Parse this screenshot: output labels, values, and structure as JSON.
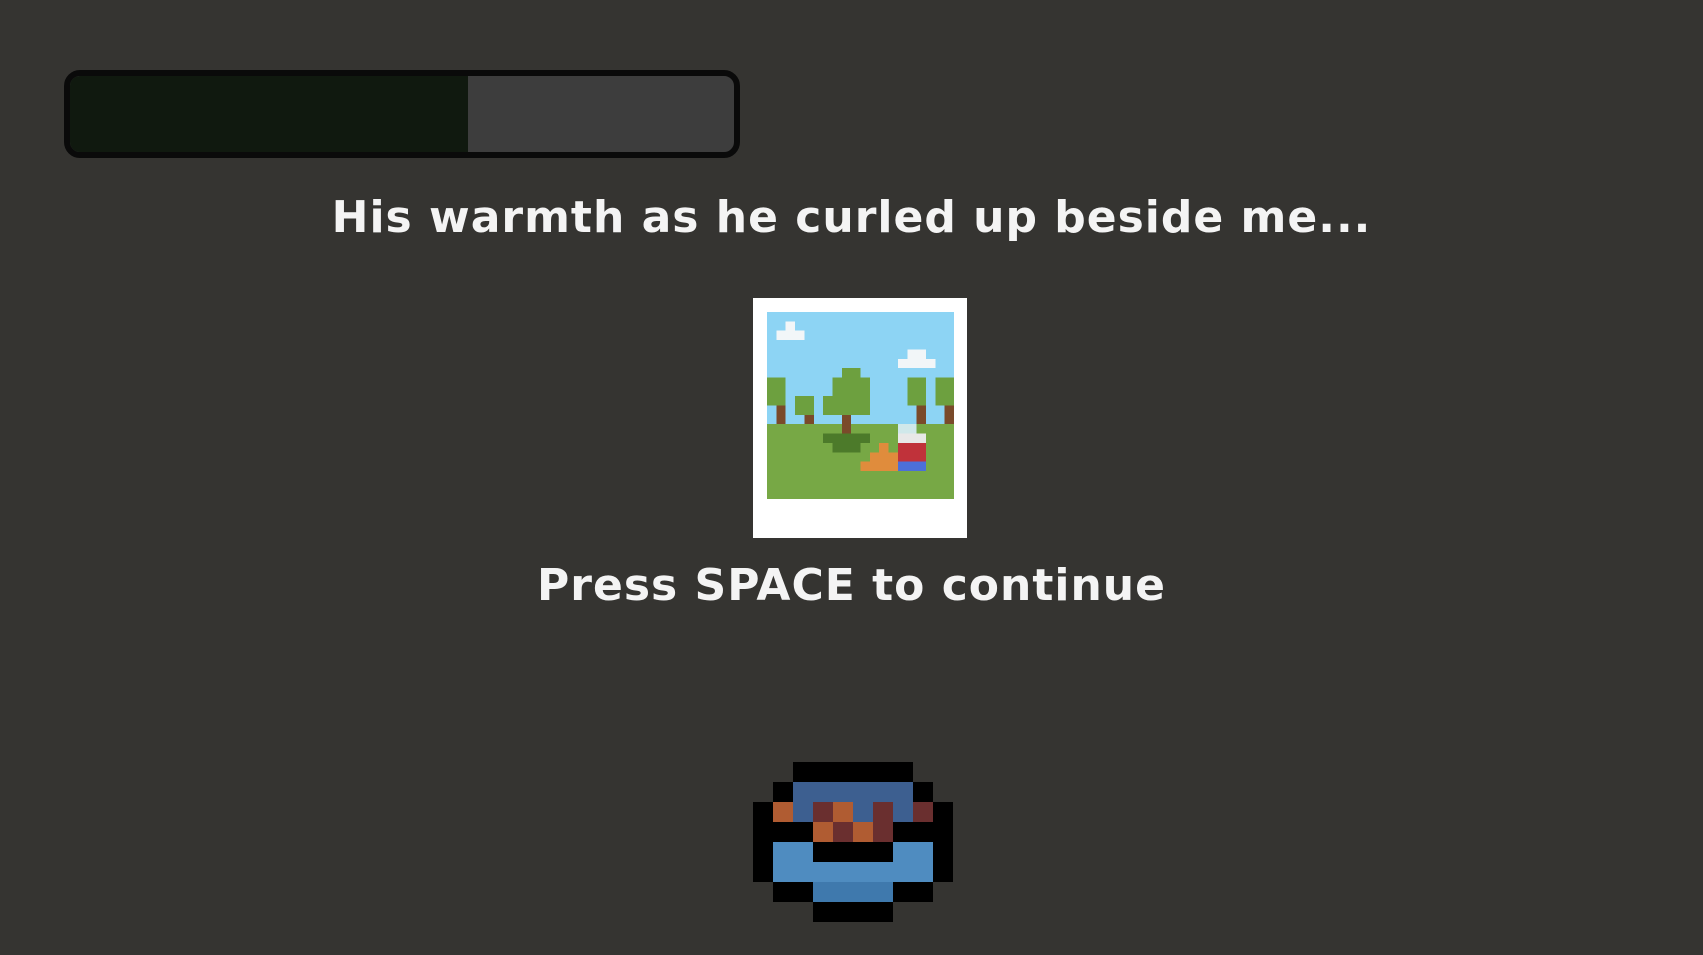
{
  "hud": {
    "progress_fraction": 0.6,
    "progress_fill_color": "#10190f",
    "progress_track_color": "#3d3d3d"
  },
  "dialogue": {
    "memory_text": "His warmth as he curled up beside me...",
    "continue_prompt": "Press SPACE to continue"
  },
  "memory_photo": {
    "icon": "polaroid-photo-icon"
  },
  "player": {
    "icon": "player-character-icon"
  },
  "colors": {
    "background": "#353431",
    "text": "#f4f4f4",
    "sky": "#8dd4f4",
    "grass": "#77a845",
    "tree": "#6da03f",
    "trunk": "#7a4a2a",
    "cat": "#e08c3c"
  }
}
